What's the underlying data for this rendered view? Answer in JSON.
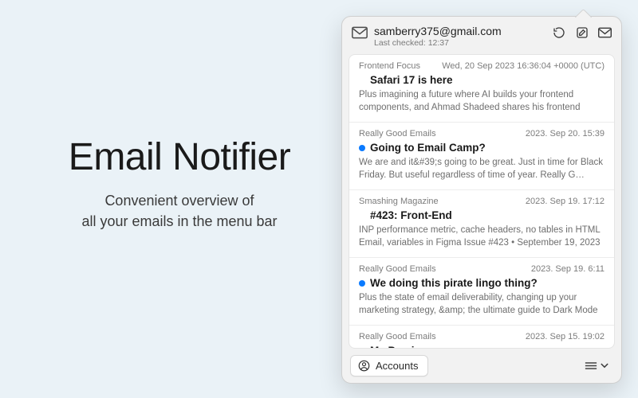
{
  "promo": {
    "title": "Email Notifier",
    "subtitle_line1": "Convenient overview of",
    "subtitle_line2": "all your emails in the menu bar"
  },
  "header": {
    "account_email": "samberry375@gmail.com",
    "last_checked_label": "Last checked: 12:37"
  },
  "footer": {
    "accounts_label": "Accounts"
  },
  "messages": [
    {
      "sender": "Frontend Focus",
      "date": "Wed, 20 Sep 2023 16:36:04 +0000 (UTC)",
      "subject": "Safari 17 is here",
      "preview": "Plus imagining a future where AI builds your frontend components, and Ahmad Shadeed shares his frontend picks. |…",
      "unread": false
    },
    {
      "sender": "Really Good Emails",
      "date": "2023. Sep 20. 15:39",
      "subject": "Going to Email Camp?",
      "preview": "We are and it&#39;s going to be great. Just in time for Black Friday. But useful regardless of time of year.             Really G…",
      "unread": true
    },
    {
      "sender": "Smashing Magazine",
      "date": "2023. Sep 19. 17:12",
      "subject": "#423: Front-End",
      "preview": "INP performance metric, cache headers, no tables in HTML Email, variables in Figma Issue #423 • September 19, 2023 •  …",
      "unread": false
    },
    {
      "sender": "Really Good Emails",
      "date": "2023. Sep 19. 6:11",
      "subject": "We doing this pirate lingo thing?",
      "preview": "Plus the state of email deliverability, changing up your marketing strategy, &amp; the ultimate guide to Dark Mode    …",
      "unread": true
    },
    {
      "sender": "Really Good Emails",
      "date": "2023. Sep 15. 19:02",
      "subject": "My Precious",
      "preview": "",
      "unread": true
    }
  ]
}
